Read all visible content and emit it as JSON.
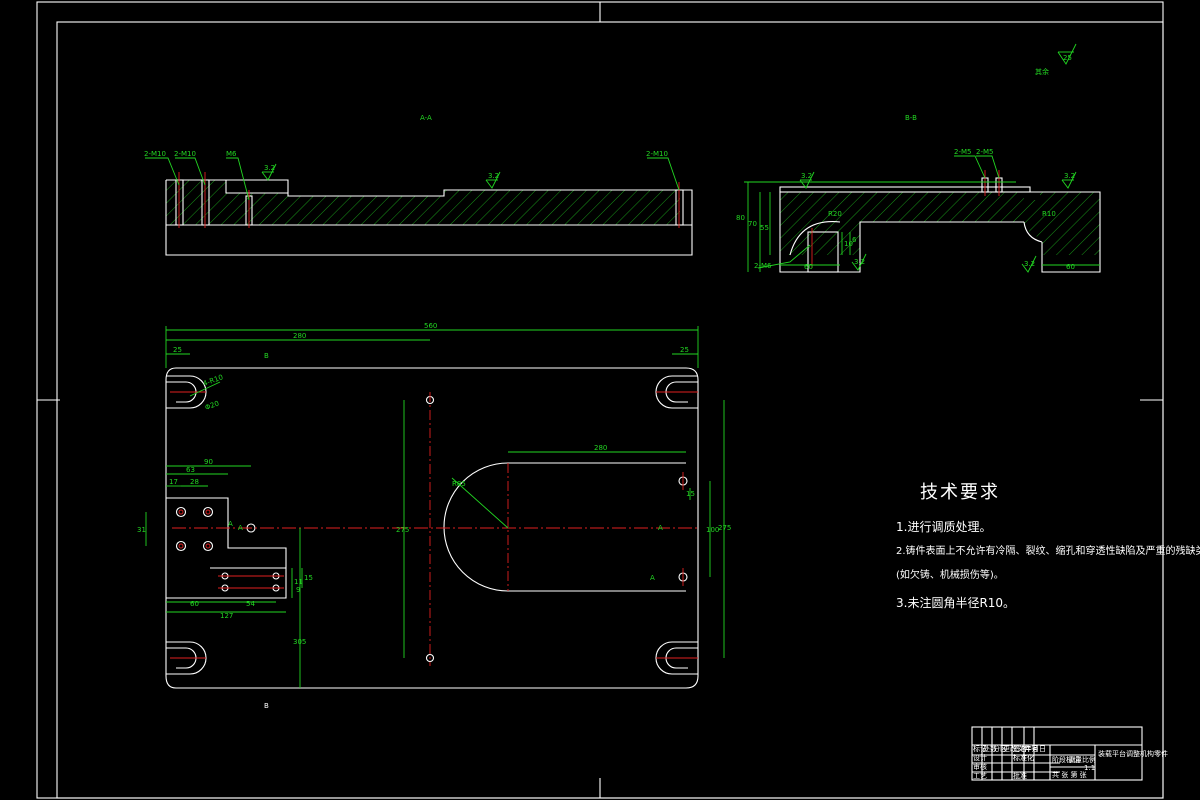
{
  "views": {
    "aa_title": "A-A",
    "bb_title": "B-B"
  },
  "aa_labels": {
    "hole1": "2-M10",
    "hole2": "2-M10",
    "hole3": "M6",
    "hole4": "2-M10",
    "rough1": "3.2",
    "rough2": "3.2"
  },
  "bb_labels": {
    "hole1": "2-M5",
    "hole2": "2-M5",
    "rough1": "3.2",
    "rough2": "3.2",
    "rough3": "3.2",
    "rough4": "3.2",
    "dim_h1": "80",
    "dim_h2": "70",
    "dim_h3": "55",
    "dim_w1": "60",
    "dim_w2": "60",
    "hole3": "2-M6",
    "r1": "R20",
    "r2": "R10",
    "d1": "10",
    "d2": "6"
  },
  "corner_rough": {
    "label": "其余",
    "value": "25"
  },
  "plan_dims": {
    "overall": "560",
    "half": "280",
    "left_edge": "25",
    "right_edge": "25",
    "slot_r": "4-R10",
    "slot_w": "Φ20",
    "d90": "90",
    "d63": "63",
    "d17": "17",
    "d28": "28",
    "d31": "31",
    "d60": "60",
    "d54": "54",
    "d127": "127",
    "d11": "11",
    "d15": "15",
    "d9": "9",
    "d305": "305",
    "d275": "275",
    "d280b": "280",
    "r85": "R85",
    "d15b": "15",
    "d100": "100",
    "d275b": "275",
    "sec_a_left": "A",
    "sec_a_right": "A",
    "sec_a_mid": "A",
    "sec_a_bot": "A",
    "sec_b_top": "B",
    "sec_b_bot": "B"
  },
  "tech": {
    "title": "技术要求",
    "item1": "1.进行调质处理。",
    "item2": "2.铸件表面上不允许有冷隔、裂纹、缩孔和穿透性缺陷及严重的残缺类缺陷",
    "item2b": "(如欠铸、机械损伤等)。",
    "item3": "3.未注圆角半径R10。"
  },
  "title_block": {
    "name": "装载平台调整机构零件",
    "c1": "标记",
    "c2": "处数",
    "c3": "分区",
    "c4": "更改文件号",
    "c5": "签名",
    "c6": "年月日",
    "c7": "设计",
    "c8": "标准化",
    "c9": "阶段标记",
    "c10": "重量",
    "c11": "比例",
    "c12": "审核",
    "c13": "工艺",
    "c14": "批准",
    "c15": "共 张 第 张",
    "scale": "1:1"
  }
}
